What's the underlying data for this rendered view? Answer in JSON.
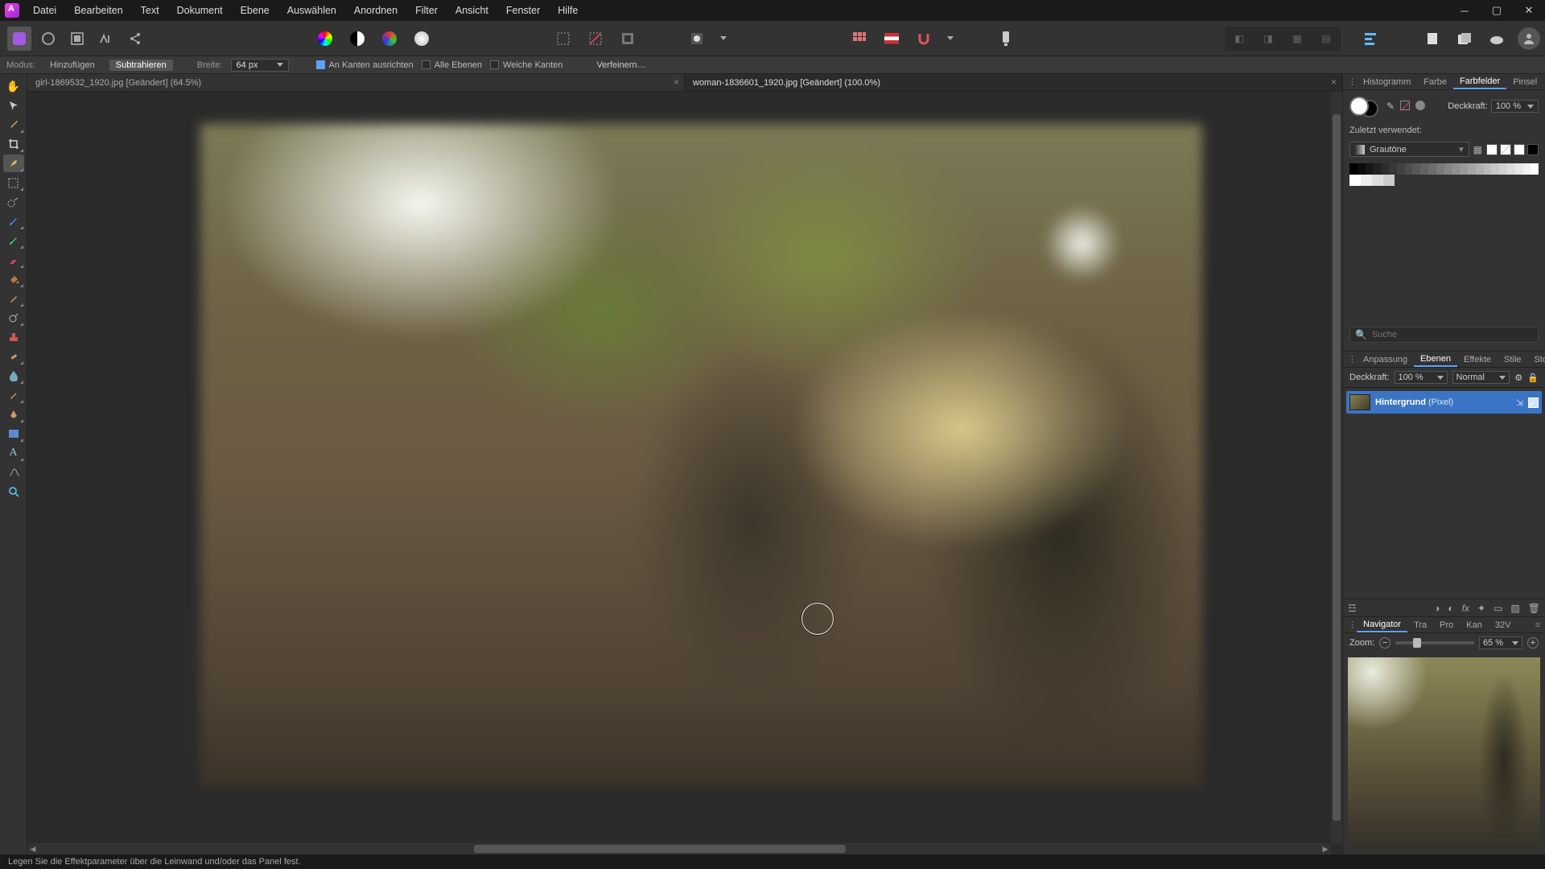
{
  "menu": [
    "Datei",
    "Bearbeiten",
    "Text",
    "Dokument",
    "Ebene",
    "Auswählen",
    "Anordnen",
    "Filter",
    "Ansicht",
    "Fenster",
    "Hilfe"
  ],
  "context": {
    "mode_label": "Modus:",
    "mode_add": "Hinzufügen",
    "mode_sub": "Subtrahieren",
    "width_label": "Breite:",
    "width_value": "64 px",
    "snap": "An Kanten ausrichten",
    "all_layers": "Alle Ebenen",
    "soft_edges": "Weiche Kanten",
    "refine": "Verfeinern…"
  },
  "tabs": [
    {
      "title": "girl-1869532_1920.jpg [Geändert] (64.5%)",
      "active": false
    },
    {
      "title": "woman-1836601_1920.jpg [Geändert] (100.0%)",
      "active": true
    }
  ],
  "status": "Legen Sie die Effektparameter über die Leinwand und/oder das Panel fest.",
  "right_tabs1": [
    "Histogramm",
    "Farbe",
    "Farbfelder",
    "Pinsel"
  ],
  "right_tabs1_active": "Farbfelder",
  "swatches": {
    "opacity_label": "Deckkraft:",
    "opacity_value": "100 %",
    "recent_label": "Zuletzt verwendet:",
    "palette_name": "Grautöne",
    "search_placeholder": "Suche"
  },
  "right_tabs2": [
    "Anpassung",
    "Ebenen",
    "Effekte",
    "Stile",
    "Stock"
  ],
  "right_tabs2_active": "Ebenen",
  "layers": {
    "opacity_label": "Deckkraft:",
    "opacity_value": "100 %",
    "blend_value": "Normal",
    "layer_name": "Hintergrund",
    "layer_type": "(Pixel)"
  },
  "right_tabs3": [
    "Navigator",
    "Tra",
    "Pro",
    "Kan",
    "32V"
  ],
  "right_tabs3_active": "Navigator",
  "navigator": {
    "zoom_label": "Zoom:",
    "zoom_value": "65 %"
  },
  "grayscale_ramp": [
    "#000",
    "#0b0b0b",
    "#161616",
    "#212121",
    "#2c2c2c",
    "#373737",
    "#424242",
    "#4d4d4d",
    "#585858",
    "#636363",
    "#6e6e6e",
    "#797979",
    "#848484",
    "#8f8f8f",
    "#9a9a9a",
    "#a5a5a5",
    "#b0b0b0",
    "#bbb",
    "#c6c6c6",
    "#d1d1d1",
    "#dcdcdc",
    "#e7e7e7",
    "#f2f2f2",
    "#fff"
  ],
  "grayscale_row2": [
    "#fff",
    "#eee",
    "#ddd",
    "#ccc"
  ]
}
